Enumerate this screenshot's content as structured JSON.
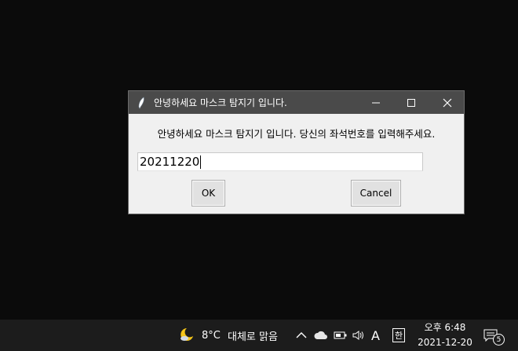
{
  "dialog": {
    "title": "안녕하세요 마스크 탐지기 입니다.",
    "prompt": "안녕하세요 마스크 탐지기 입니다. 당신의 좌석번호를 입력해주세요.",
    "input_value": "20211220",
    "ok_label": "OK",
    "cancel_label": "Cancel",
    "title_icon": "feather-icon",
    "controls": [
      "minimize-icon",
      "maximize-icon",
      "close-icon"
    ]
  },
  "taskbar": {
    "weather_icon": "moon-cloud-icon",
    "temperature": "8°C",
    "condition": "대체로 맑음",
    "ime_mode": "A",
    "ime_lang": "한",
    "time": "오후 6:48",
    "date": "2021-12-20",
    "notification_count": "5",
    "tray_icons": [
      "chevron-up-icon",
      "onedrive-cloud-icon",
      "battery-icon",
      "volume-icon"
    ]
  },
  "colors": {
    "desktop": "#0b0b0b",
    "titlebar": "#4a4a4a",
    "dialog_bg": "#f0f0f0",
    "taskbar": "#1c1c1c",
    "moon": "#f5c518"
  }
}
